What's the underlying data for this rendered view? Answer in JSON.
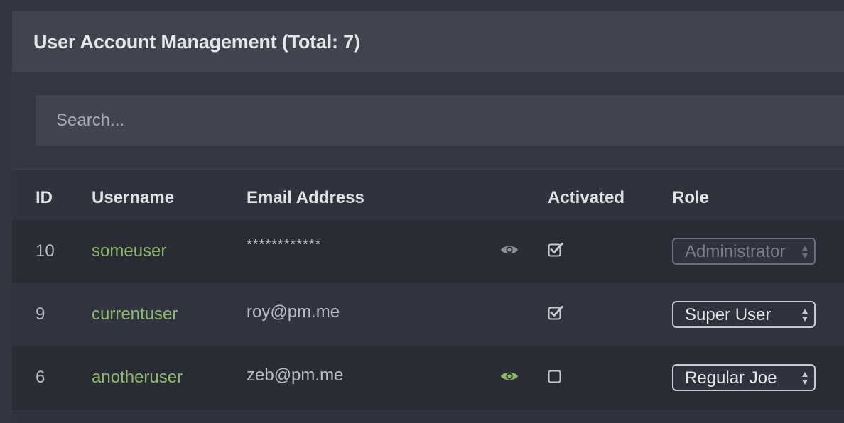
{
  "panel": {
    "title": "User Account Management (Total: 7)"
  },
  "search": {
    "placeholder": "Search..."
  },
  "table": {
    "headers": {
      "id": "ID",
      "username": "Username",
      "email": "Email Address",
      "activated": "Activated",
      "role": "Role"
    },
    "rows": [
      {
        "id": "10",
        "username": "someuser",
        "email": "************",
        "email_masked": true,
        "reveal_icon": "eye-icon",
        "reveal_color": "#8a8e96",
        "activated": true,
        "role": "Administrator",
        "role_disabled": true
      },
      {
        "id": "9",
        "username": "currentuser",
        "email": "roy@pm.me",
        "email_masked": false,
        "activated": true,
        "role": "Super User",
        "role_disabled": false
      },
      {
        "id": "6",
        "username": "anotheruser",
        "email": "zeb@pm.me",
        "email_masked": false,
        "reveal_icon": "eye-icon",
        "reveal_color": "#8fb86b",
        "activated": false,
        "role": "Regular Joe",
        "role_disabled": false
      }
    ]
  },
  "colors": {
    "accent_green": "#8fb86b",
    "header_bg": "#40444f",
    "row_dark": "#292c35",
    "row_light": "#30343e"
  }
}
